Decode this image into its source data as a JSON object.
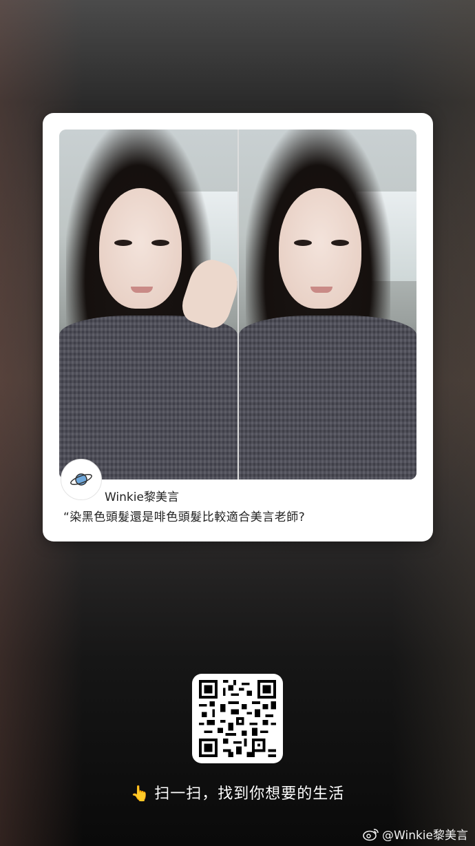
{
  "card": {
    "author": "Winkie黎美言",
    "quote": "“染黑色頭髮還是啡色頭髮比較適合美言老師?"
  },
  "scan": {
    "text": "扫一扫，找到你想要的生活",
    "icon": "pointing-hand-icon"
  },
  "watermark": {
    "text": "@Winkie黎美言",
    "icon": "weibo-icon"
  },
  "avatar": {
    "icon": "planet-icon"
  },
  "colors": {
    "card_bg": "#ffffff",
    "text_dark": "#222222",
    "text_light": "#ffffff"
  }
}
